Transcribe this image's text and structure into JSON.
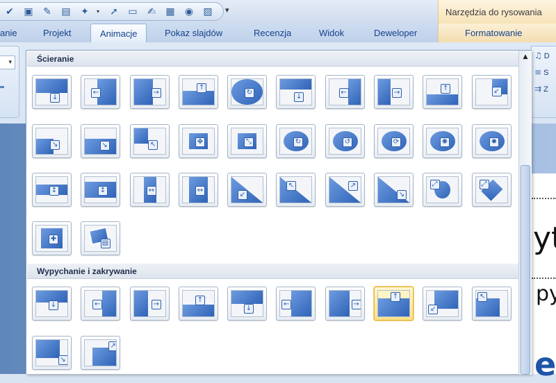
{
  "quick_access": {
    "icons": [
      "spellcheck-icon",
      "slideshow-icon",
      "research-icon",
      "new-slide-icon",
      "shapes-icon",
      "select-icon",
      "textbox-icon",
      "edit-icon",
      "paste-icon",
      "globe-icon",
      "picture-icon"
    ],
    "more_glyph": "▾"
  },
  "contextual_tab_group": {
    "title": "Narzędzia do rysowania"
  },
  "tabs": [
    {
      "label": "anie",
      "active": false
    },
    {
      "label": "Projekt",
      "active": false
    },
    {
      "label": "Animacje",
      "active": true
    },
    {
      "label": "Pokaz slajdów",
      "active": false
    },
    {
      "label": "Recenzja",
      "active": false
    },
    {
      "label": "Widok",
      "active": false
    },
    {
      "label": "Deweloper",
      "active": false
    },
    {
      "label": "Formatowanie",
      "active": false
    }
  ],
  "right_panel": {
    "items": [
      {
        "icon": "sound-icon",
        "label": "D"
      },
      {
        "icon": "speed-icon",
        "label": "S"
      },
      {
        "icon": "apply-all-icon",
        "label": "Z"
      }
    ]
  },
  "slide": {
    "text1": "yt",
    "text2": "py",
    "logo": "ek"
  },
  "gallery": {
    "sections": [
      {
        "title": "Ścieranie"
      },
      {
        "title": "Wypychanie i zakrywanie"
      }
    ],
    "selected_index": 7,
    "colors": {
      "accent": "#2f63b7",
      "selected": "#ffe08a"
    }
  },
  "left_combo": {
    "glyph": "▾"
  }
}
